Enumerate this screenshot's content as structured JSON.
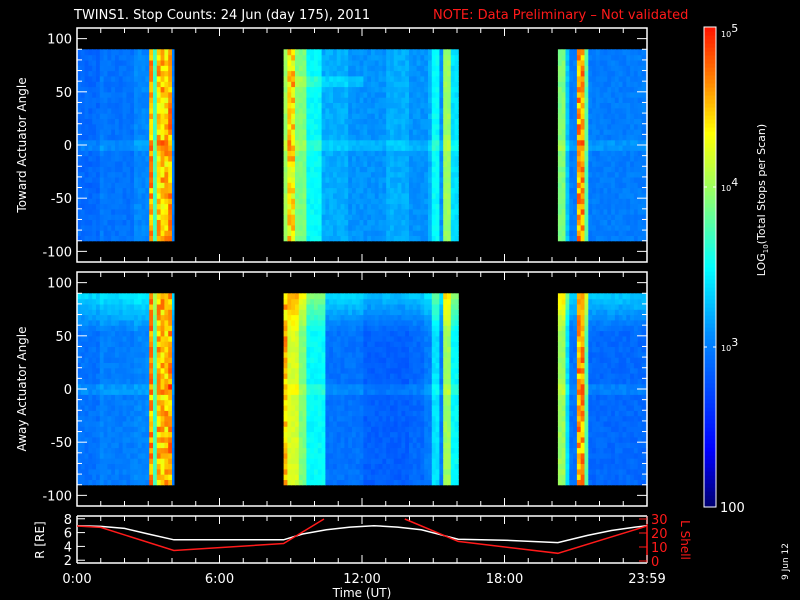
{
  "title": {
    "main": "TWINS1. Stop Counts: 24 Jun (day 175), 2011",
    "note": "NOTE: Data Preliminary – Not validated",
    "note_color": "#ff1a1a"
  },
  "side_stamp": "9 Jun 12",
  "colorbar": {
    "label": "LOG10(Total Stops per Scan)",
    "label_prefix": "LOG",
    "label_sub": "10",
    "label_rest": "(Total Stops per Scan)",
    "ticks": [
      {
        "base": "10",
        "exp": "5"
      },
      {
        "base": "10",
        "exp": "4"
      },
      {
        "base": "10",
        "exp": "3"
      }
    ],
    "min_label": "100",
    "range_log10": [
      2,
      5
    ]
  },
  "chart_data": [
    {
      "type": "heatmap",
      "name": "toward",
      "ylabel": "Toward Actuator Angle",
      "ylim": [
        -110,
        110
      ],
      "yticks": [
        "100",
        "50",
        "0",
        "-50",
        "-100"
      ],
      "ytick_values": [
        100,
        50,
        0,
        -50,
        -100
      ],
      "angle_range": [
        -90,
        90
      ],
      "xlim_hours": [
        0,
        24
      ],
      "data_segments_hours": [
        [
          0,
          4.08
        ],
        [
          8.7,
          16.05
        ],
        [
          20.25,
          24
        ]
      ],
      "log_profile": [
        [
          0,
          2.9
        ],
        [
          1.0,
          3.0
        ],
        [
          1.05,
          3.4
        ],
        [
          1.2,
          2.95
        ],
        [
          2.4,
          3.05
        ],
        [
          3.0,
          3.3
        ],
        [
          3.05,
          4.6
        ],
        [
          3.2,
          3.7
        ],
        [
          3.35,
          4.5
        ],
        [
          3.9,
          4.6
        ],
        [
          4.08,
          3.0
        ],
        [
          8.7,
          4.0
        ],
        [
          8.8,
          4.4
        ],
        [
          9.2,
          3.9
        ],
        [
          9.6,
          3.5
        ],
        [
          10.3,
          3.2
        ],
        [
          11.5,
          3.1
        ],
        [
          13.0,
          3.2
        ],
        [
          14.0,
          3.1
        ],
        [
          14.8,
          3.2
        ],
        [
          15.0,
          3.5
        ],
        [
          15.2,
          3.1
        ],
        [
          15.5,
          4.0
        ],
        [
          15.75,
          3.4
        ],
        [
          16.05,
          3.4
        ],
        [
          20.25,
          3.9
        ],
        [
          20.55,
          3.3
        ],
        [
          20.75,
          3.0
        ],
        [
          21.0,
          4.6
        ],
        [
          21.3,
          3.8
        ],
        [
          21.5,
          3.0
        ],
        [
          24,
          3.0
        ]
      ]
    },
    {
      "type": "heatmap",
      "name": "away",
      "ylabel": "Away Actuator Angle",
      "ylim": [
        -110,
        110
      ],
      "yticks": [
        "100",
        "50",
        "0",
        "-50",
        "-100"
      ],
      "ytick_values": [
        100,
        50,
        0,
        -50,
        -100
      ],
      "angle_range": [
        -90,
        90
      ],
      "xlim_hours": [
        0,
        24
      ],
      "data_segments_hours": [
        [
          0,
          4.08
        ],
        [
          8.7,
          16.05
        ],
        [
          20.25,
          24
        ]
      ],
      "log_profile": [
        [
          0,
          2.95
        ],
        [
          1.0,
          3.05
        ],
        [
          1.05,
          3.4
        ],
        [
          1.2,
          3.0
        ],
        [
          2.4,
          3.05
        ],
        [
          3.0,
          3.3
        ],
        [
          3.05,
          4.6
        ],
        [
          3.2,
          3.7
        ],
        [
          3.35,
          4.5
        ],
        [
          3.9,
          4.6
        ],
        [
          4.08,
          3.0
        ],
        [
          8.7,
          4.5
        ],
        [
          8.9,
          4.2
        ],
        [
          9.3,
          3.9
        ],
        [
          9.7,
          3.5
        ],
        [
          10.5,
          2.95
        ],
        [
          12.0,
          2.85
        ],
        [
          14.0,
          2.9
        ],
        [
          14.7,
          3.0
        ],
        [
          15.0,
          3.4
        ],
        [
          15.2,
          3.0
        ],
        [
          15.5,
          4.0
        ],
        [
          15.75,
          3.5
        ],
        [
          16.05,
          3.5
        ],
        [
          20.25,
          4.0
        ],
        [
          20.55,
          3.4
        ],
        [
          20.75,
          2.95
        ],
        [
          21.0,
          4.6
        ],
        [
          21.3,
          3.8
        ],
        [
          21.5,
          2.9
        ],
        [
          24,
          2.9
        ]
      ]
    },
    {
      "type": "line",
      "name": "orbit",
      "xlabel": "Time (UT)",
      "xticks": [
        "0:00",
        "6:00",
        "12:00",
        "18:00",
        "23:59"
      ],
      "xtick_hours": [
        0,
        6,
        12,
        18,
        24
      ],
      "ylabel_left": "R [RE]",
      "ylabel_left_main": "R [R",
      "ylabel_left_sub": "E",
      "ylabel_left_end": "]",
      "ylim_left": [
        1.6,
        8.4
      ],
      "yticks_left": [
        "2",
        "4",
        "6",
        "8"
      ],
      "ytick_values_left": [
        2,
        4,
        6,
        8
      ],
      "ylabel_right": "L Shell",
      "ylim_right": [
        0,
        30
      ],
      "yticks_right": [
        "0",
        "10",
        "20",
        "30"
      ],
      "ytick_values_right": [
        0,
        10,
        20,
        30
      ],
      "series": [
        {
          "name": "R",
          "color": "#ffffff",
          "axis": "left",
          "x": [
            0,
            1,
            2,
            3,
            4.08,
            8.7,
            9.5,
            10.5,
            11.5,
            12.5,
            13.5,
            14.5,
            15.3,
            16.05,
            18,
            20.25,
            21.5,
            22.5,
            23.5,
            24
          ],
          "y": [
            7.0,
            6.9,
            6.6,
            5.8,
            4.95,
            4.95,
            5.8,
            6.4,
            6.8,
            7.0,
            6.8,
            6.4,
            5.7,
            5.05,
            4.9,
            4.55,
            5.6,
            6.3,
            6.8,
            7.0
          ]
        },
        {
          "name": "L Shell",
          "color": "#ff1a1a",
          "axis": "right",
          "x": [
            0,
            1,
            4.08,
            8.7,
            10.4
          ],
          "y": [
            25,
            24,
            7.5,
            12.5,
            30
          ]
        },
        {
          "name": "L Shell (b)",
          "color": "#ff1a1a",
          "axis": "right",
          "x": [
            13.8,
            16.05,
            20.25,
            24
          ],
          "y": [
            30,
            14,
            5.5,
            25
          ]
        }
      ]
    }
  ]
}
